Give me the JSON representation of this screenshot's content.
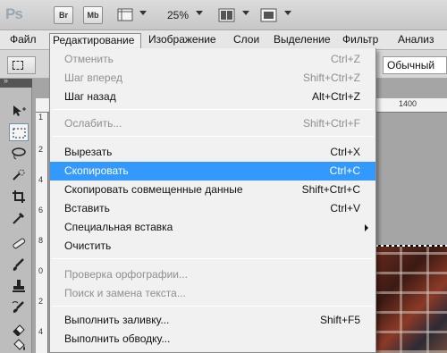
{
  "app": {
    "logo": "Ps",
    "bridge_label": "Br",
    "minibridge_label": "Mb",
    "zoom": "25%"
  },
  "menubar": {
    "items": [
      "Файл",
      "Редактирование",
      "Изображение",
      "Слои",
      "Выделение",
      "Фильтр",
      "Анализ"
    ]
  },
  "options": {
    "style_value": "Обычный"
  },
  "ruler": {
    "top_label": "1400",
    "left_labels": [
      "1",
      "2",
      "4",
      "6",
      "8",
      "0",
      "2",
      "4"
    ]
  },
  "edit_menu": {
    "items": [
      {
        "label": "Отменить",
        "shortcut": "Ctrl+Z",
        "state": "disabled"
      },
      {
        "label": "Шаг вперед",
        "shortcut": "Shift+Ctrl+Z",
        "state": "disabled"
      },
      {
        "label": "Шаг назад",
        "shortcut": "Alt+Ctrl+Z",
        "state": "enabled"
      },
      {
        "label": "Ослабить...",
        "shortcut": "Shift+Ctrl+F",
        "state": "disabled"
      },
      {
        "label": "Вырезать",
        "shortcut": "Ctrl+X",
        "state": "enabled"
      },
      {
        "label": "Скопировать",
        "shortcut": "Ctrl+C",
        "state": "highlighted"
      },
      {
        "label": "Скопировать совмещенные данные",
        "shortcut": "Shift+Ctrl+C",
        "state": "enabled"
      },
      {
        "label": "Вставить",
        "shortcut": "Ctrl+V",
        "state": "enabled"
      },
      {
        "label": "Специальная вставка",
        "shortcut": "",
        "state": "submenu"
      },
      {
        "label": "Очистить",
        "shortcut": "",
        "state": "enabled"
      },
      {
        "label": "Проверка орфографии...",
        "shortcut": "",
        "state": "disabled"
      },
      {
        "label": "Поиск и замена текста...",
        "shortcut": "",
        "state": "disabled"
      },
      {
        "label": "Выполнить заливку...",
        "shortcut": "Shift+F5",
        "state": "enabled"
      },
      {
        "label": "Выполнить обводку...",
        "shortcut": "",
        "state": "enabled"
      }
    ]
  },
  "colors": {
    "highlight": "#3399ff",
    "disabled_text": "#8f8f8f"
  },
  "icons": {
    "tools": [
      "move-tool-icon",
      "marquee-tool-icon",
      "lasso-tool-icon",
      "quick-selection-tool-icon",
      "crop-tool-icon",
      "eyedropper-tool-icon",
      "healing-brush-tool-icon",
      "brush-tool-icon",
      "clone-stamp-tool-icon",
      "history-brush-tool-icon",
      "eraser-tool-icon",
      "paint-bucket-tool-icon"
    ]
  }
}
